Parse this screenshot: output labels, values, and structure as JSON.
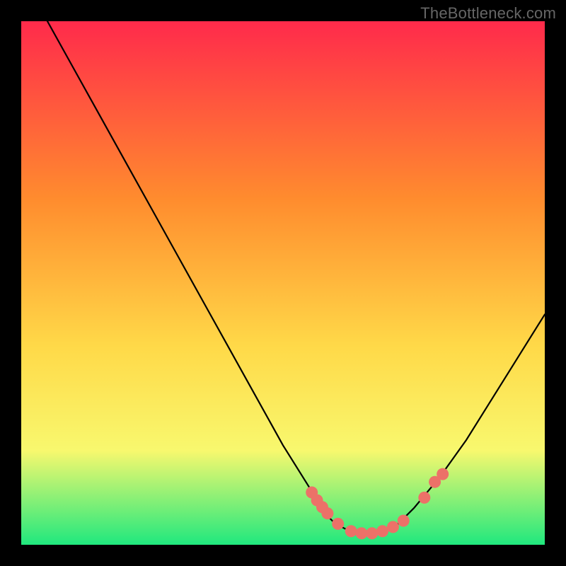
{
  "watermark": "TheBottleneck.com",
  "colors": {
    "background": "#000000",
    "watermark_text": "#666666",
    "curve_stroke": "#000000",
    "marker_fill": "#EC7168",
    "gradient_top": "#FF2A4B",
    "gradient_mid1": "#FF8C2E",
    "gradient_mid2": "#FFD948",
    "gradient_mid3": "#F8F86E",
    "gradient_bottom": "#20E87E"
  },
  "chart_data": {
    "type": "line",
    "title": "",
    "xlabel": "",
    "ylabel": "",
    "xlim": [
      0,
      100
    ],
    "ylim": [
      0,
      100
    ],
    "curve": {
      "x": [
        5,
        10,
        15,
        20,
        25,
        30,
        35,
        40,
        45,
        50,
        55,
        58,
        60,
        62,
        64,
        66,
        68,
        70,
        72,
        75,
        80,
        85,
        90,
        95,
        100
      ],
      "y": [
        100,
        91,
        82,
        73,
        64,
        55,
        46,
        37,
        28,
        19,
        11,
        6,
        4,
        3,
        2,
        2,
        2,
        3,
        4,
        7,
        13,
        20,
        28,
        36,
        44
      ]
    },
    "markers": {
      "x": [
        55.5,
        56.5,
        57.5,
        58.5,
        60.5,
        63.0,
        65.0,
        67.0,
        69.0,
        71.0,
        73.0,
        77.0,
        79.0,
        80.5
      ],
      "y": [
        10.0,
        8.5,
        7.2,
        6.0,
        4.0,
        2.6,
        2.2,
        2.2,
        2.6,
        3.4,
        4.6,
        9.0,
        12.0,
        13.5
      ]
    }
  }
}
